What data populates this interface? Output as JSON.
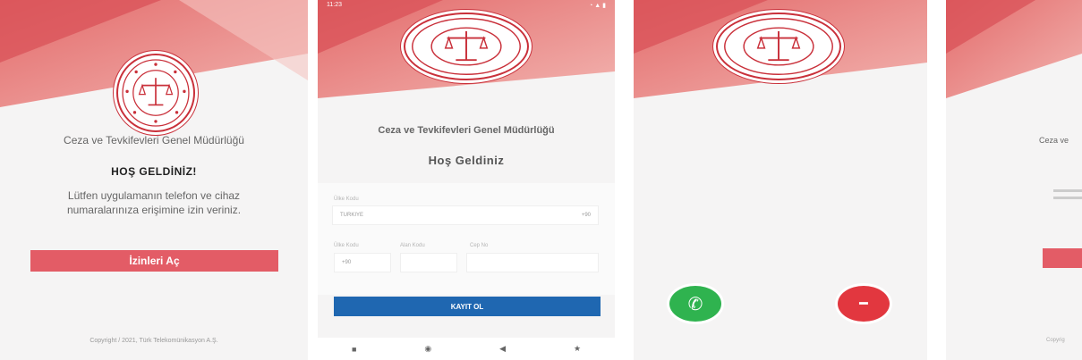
{
  "screen1": {
    "org_name": "Ceza ve Tevkifevleri Genel Müdürlüğü",
    "welcome": "HOŞ GELDİNİZ!",
    "description": "Lütfen uygulamanın telefon ve cihaz numaralarınıza erişimine izin veriniz.",
    "permissions_button": "İzinleri Aç",
    "copyright": "Copyright / 2021, Türk Telekomünikasyon A.Ş."
  },
  "screen2": {
    "status_time": "11:23",
    "org_name": "Ceza ve Tevkifevleri Genel Müdürlüğü",
    "welcome": "Hoş Geldiniz",
    "country_label": "Ülke Kodu",
    "country_value": "TURKIYE",
    "country_code": "+90",
    "field_labels": [
      "Ülke Kodu",
      "Alan Kodu",
      "Cep No"
    ],
    "field_values": [
      "+90",
      "",
      ""
    ],
    "register_button": "KAYIT OL",
    "nav_icons": [
      "■",
      "◉",
      "◀",
      "★"
    ]
  },
  "screen3": {
    "accept_icon": "phone-accept-icon",
    "decline_icon": "phone-decline-icon"
  },
  "screen4": {
    "org_name_partial": "Ceza ve",
    "copyright_partial": "Copyrig"
  },
  "colors": {
    "primary_red": "#e35c66",
    "seal_red": "#c9303a",
    "register_blue": "#1f67b1",
    "accept_green": "#2fb34f",
    "decline_red": "#e2373f"
  }
}
